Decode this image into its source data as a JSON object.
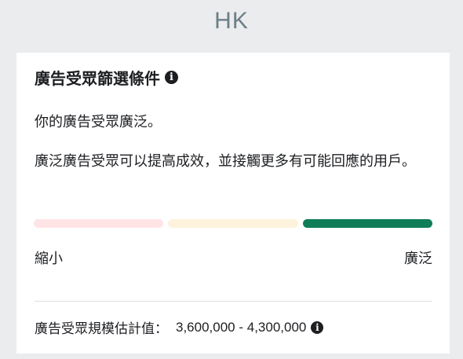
{
  "region": "HK",
  "card": {
    "title": "廣告受眾篩選條件",
    "title_info_icon": "info-icon",
    "desc_line1": "你的廣告受眾廣泛。",
    "desc_line2": "廣泛廣告受眾可以提高成效，並接觸更多有可能回應的用戶。",
    "meter": {
      "level": "broad",
      "segments": [
        {
          "name": "narrow",
          "color": "#ffe4e6",
          "active": false
        },
        {
          "name": "medium",
          "color": "#fdf3dc",
          "active": false
        },
        {
          "name": "broad",
          "color": "#0f7d58",
          "active": true
        }
      ]
    },
    "label_narrow": "縮小",
    "label_broad": "廣泛",
    "estimate_label": "廣告受眾規模估計值：",
    "estimate_value": "3,600,000 - 4,300,000",
    "estimate_info_icon": "info-icon"
  }
}
